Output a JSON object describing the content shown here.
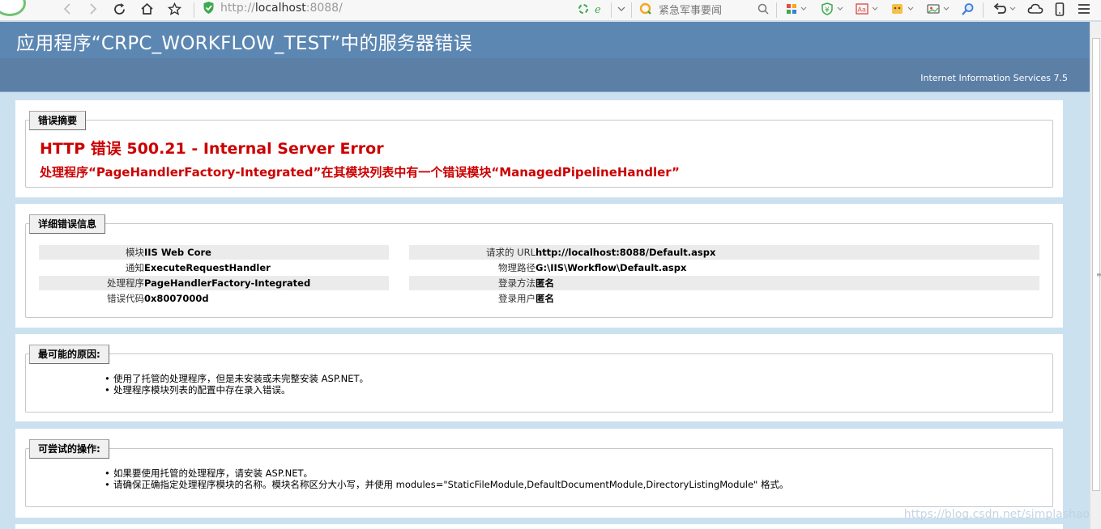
{
  "browser": {
    "url_prefix": "http://",
    "url_host": "localhost",
    "url_suffix": ":8088/",
    "search_placeholder": "紧急军事要闻"
  },
  "header": {
    "title": "应用程序“CRPC_WORKFLOW_TEST”中的服务器错误",
    "server_info": "Internet Information Services 7.5"
  },
  "summary": {
    "legend": "错误摘要",
    "title": "HTTP 错误 500.21 - Internal Server Error",
    "subtitle": "处理程序“PageHandlerFactory-Integrated”在其模块列表中有一个错误模块“ManagedPipelineHandler”"
  },
  "details": {
    "legend": "详细错误信息",
    "left": [
      {
        "label": "模块",
        "value": "IIS Web Core"
      },
      {
        "label": "通知",
        "value": "ExecuteRequestHandler"
      },
      {
        "label": "处理程序",
        "value": "PageHandlerFactory-Integrated"
      },
      {
        "label": "错误代码",
        "value": "0x8007000d"
      }
    ],
    "right": [
      {
        "label": "请求的 URL",
        "value": "http://localhost:8088/Default.aspx"
      },
      {
        "label": "物理路径",
        "value": "G:\\IIS\\Workflow\\Default.aspx"
      },
      {
        "label": "登录方法",
        "value": "匿名"
      },
      {
        "label": "登录用户",
        "value": "匿名"
      }
    ]
  },
  "causes": {
    "legend": "最可能的原因:",
    "items": [
      "使用了托管的处理程序，但是未安装或未完整安装 ASP.NET。",
      "处理程序模块列表的配置中存在录入错误。"
    ]
  },
  "actions": {
    "legend": "可尝试的操作:",
    "items": [
      "如果要使用托管的处理程序，请安装 ASP.NET。",
      "请确保正确指定处理程序模块的名称。模块名称区分大小写，并使用 modules=\"StaticFileModule,DefaultDocumentModule,DirectoryListingModule\" 格式。"
    ]
  },
  "watermark": "https://blog.csdn.net/simplashao"
}
